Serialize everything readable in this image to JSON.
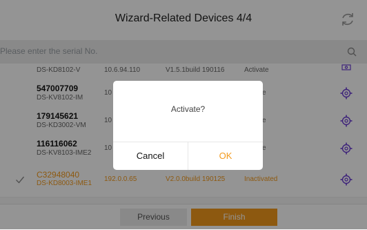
{
  "header": {
    "title": "Wizard-Related Devices 4/4",
    "refresh_icon": "refresh-icon"
  },
  "search": {
    "placeholder": "Please enter the serial No.",
    "icon": "search-icon"
  },
  "devices": [
    {
      "serial": "",
      "model": "DS-KD8102-V",
      "ip": "10.6.94.110",
      "version": "V1.5.1build 190116",
      "status": "Activate",
      "action_icon": "device-config-icon"
    },
    {
      "serial": "547007709",
      "model": "DS-KV8102-IM",
      "ip": "10",
      "version": "",
      "status": "e",
      "action_icon": "gear-icon"
    },
    {
      "serial": "179145621",
      "model": "DS-KD3002-VM",
      "ip": "10",
      "version": "",
      "status": "e",
      "action_icon": "gear-icon"
    },
    {
      "serial": "116116062",
      "model": "DS-KV8103-IME2",
      "ip": "10",
      "version": "",
      "status": "e",
      "action_icon": "gear-icon"
    },
    {
      "serial": "C32948040",
      "model": "DS-KD8003-IME1",
      "ip": "192.0.0.65",
      "version": "V2.0.0build 190125",
      "status": "Inactivated",
      "action_icon": "gear-icon",
      "selected": true
    }
  ],
  "footer": {
    "previous_label": "Previous",
    "finish_label": "Finish"
  },
  "dialog": {
    "message": "Activate?",
    "cancel_label": "Cancel",
    "ok_label": "OK"
  },
  "colors": {
    "accent": "#f39a1d",
    "overlay": "rgba(0,0,0,0.42)"
  }
}
